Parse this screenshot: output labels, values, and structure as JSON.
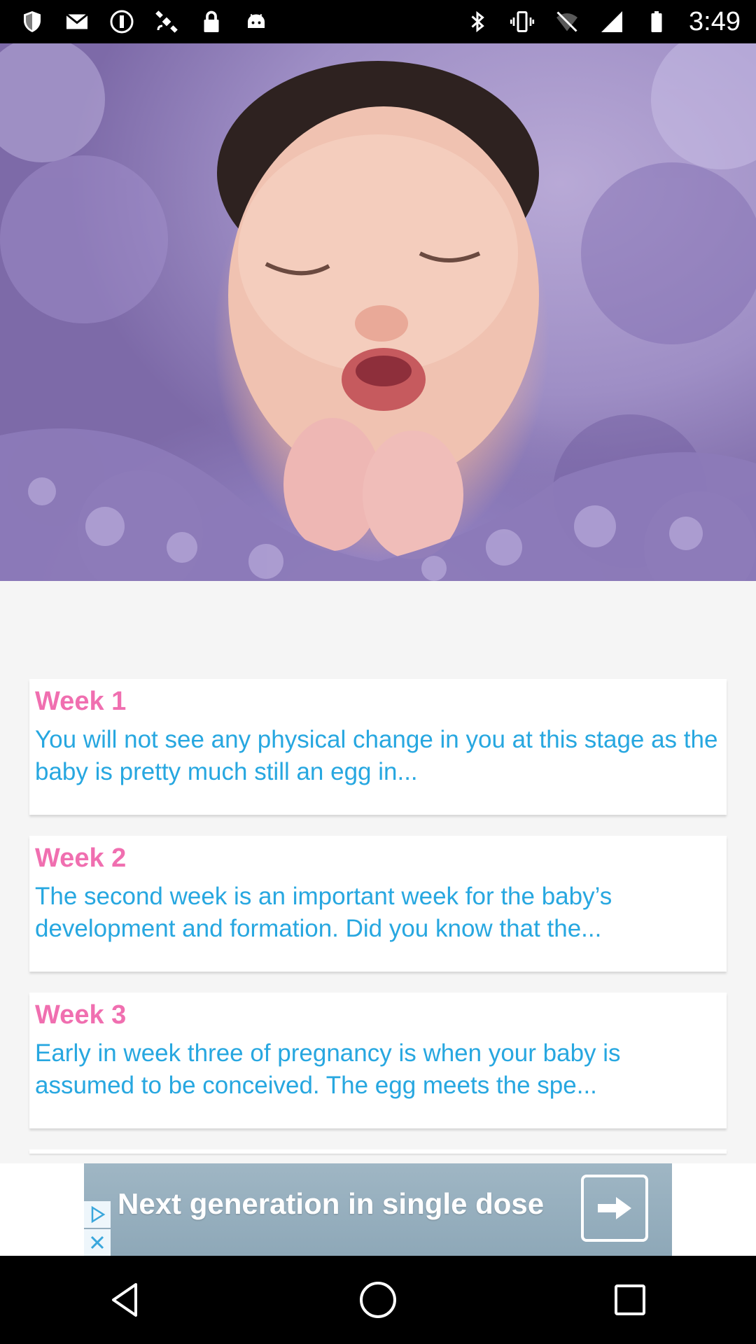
{
  "status_bar": {
    "time": "3:49",
    "left_icons": [
      "shield-icon",
      "mail-icon",
      "info-circle-icon",
      "satellite-icon",
      "lock-icon",
      "android-icon"
    ],
    "right_icons": [
      "bluetooth-icon",
      "vibrate-icon",
      "wifi-off-icon",
      "signal-icon",
      "battery-icon"
    ]
  },
  "hero": {
    "image": "sleeping-newborn-baby-photo"
  },
  "weeks": [
    {
      "title": "Week 1",
      "body": "You will not see any physical change in you at this stage as the baby is pretty much still an egg in..."
    },
    {
      "title": "Week 2",
      "body": "The second week is an important week for the baby’s development and formation. Did you know that the..."
    },
    {
      "title": "Week 3",
      "body": "Early in week three of pregnancy is when your baby is assumed to be conceived. The egg meets the spe..."
    }
  ],
  "ad": {
    "text": "Next generation in single dose",
    "arrow_icon": "arrow-right-icon",
    "play_icon": "ad-choices-icon",
    "close_icon": "close-icon"
  },
  "nav": {
    "back_icon": "back-triangle-icon",
    "home_icon": "home-circle-icon",
    "recents_icon": "recents-square-icon"
  },
  "colors": {
    "week_title": "#f06fb0",
    "week_body": "#27a7e0",
    "background": "#f5f5f5",
    "ad_banner": "#9fb6c4"
  }
}
